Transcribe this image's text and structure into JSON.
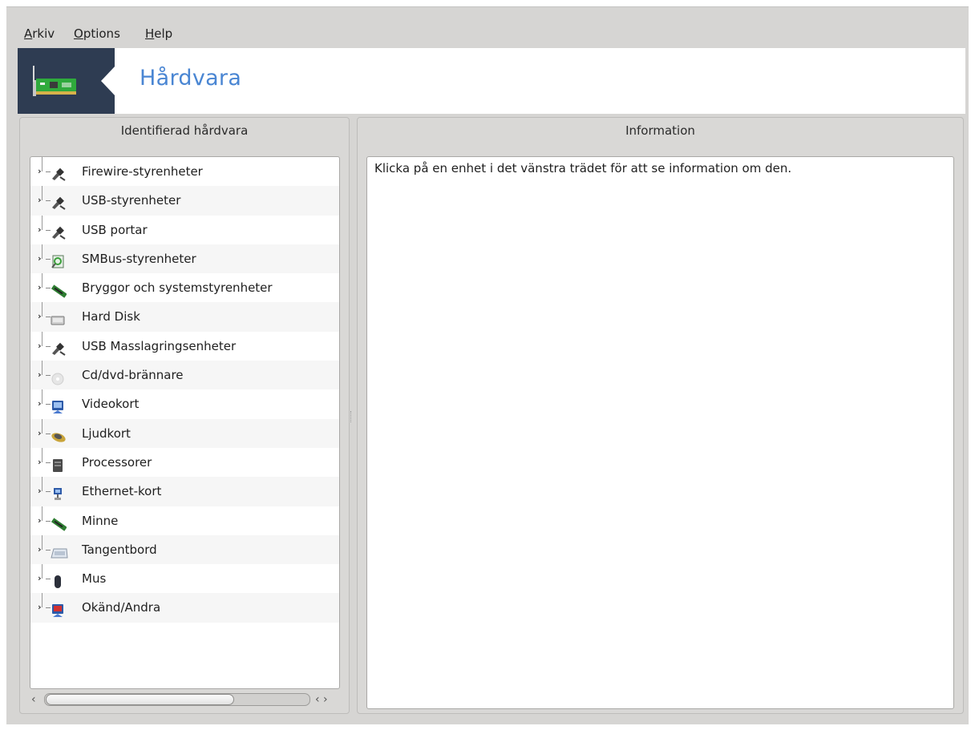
{
  "menu": {
    "items": [
      {
        "mnemonic": "A",
        "rest": "rkiv"
      },
      {
        "mnemonic": "O",
        "rest": "ptions"
      },
      {
        "mnemonic": "H",
        "rest": "elp"
      }
    ]
  },
  "banner": {
    "title": "Hårdvara"
  },
  "left_panel": {
    "title": "Identifierad hårdvara",
    "tree": [
      {
        "label": "Firewire-styrenheter",
        "icon": "usb-plug-icon"
      },
      {
        "label": "USB-styrenheter",
        "icon": "usb-plug-icon"
      },
      {
        "label": "USB portar",
        "icon": "usb-plug-icon"
      },
      {
        "label": "SMBus-styrenheter",
        "icon": "smbus-icon"
      },
      {
        "label": "Bryggor och systemstyrenheter",
        "icon": "memory-module-icon"
      },
      {
        "label": "Hard Disk",
        "icon": "hard-disk-icon"
      },
      {
        "label": "USB Masslagringsenheter",
        "icon": "usb-plug-icon"
      },
      {
        "label": "Cd/dvd-brännare",
        "icon": "optical-disc-icon"
      },
      {
        "label": "Videokort",
        "icon": "monitor-icon"
      },
      {
        "label": "Ljudkort",
        "icon": "speaker-icon"
      },
      {
        "label": "Processorer",
        "icon": "cpu-icon"
      },
      {
        "label": "Ethernet-kort",
        "icon": "network-icon"
      },
      {
        "label": "Minne",
        "icon": "memory-module-icon"
      },
      {
        "label": "Tangentbord",
        "icon": "keyboard-icon"
      },
      {
        "label": "Mus",
        "icon": "mouse-icon"
      },
      {
        "label": "Okänd/Andra",
        "icon": "unknown-device-icon"
      }
    ],
    "scrollbar": {
      "left_arrow": "‹",
      "right_arrows": "‹ ›"
    }
  },
  "right_panel": {
    "title": "Information",
    "text": "Klicka på en enhet i det vänstra trädet för att se information om den."
  },
  "colors": {
    "banner_title": "#4a86d3",
    "banner_logo_bg": "#2e3c52",
    "window_bg": "#d6d5d3"
  }
}
